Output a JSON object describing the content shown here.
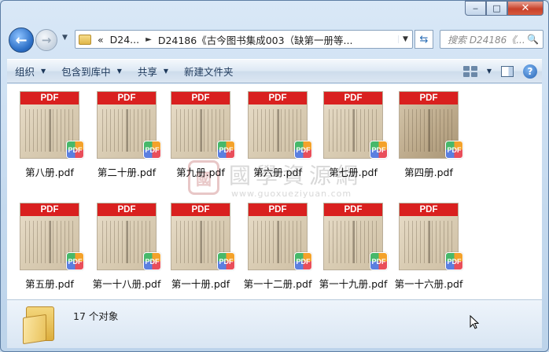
{
  "window": {
    "caption": {
      "minimize": "‒",
      "maximize": "□",
      "close": "✕"
    }
  },
  "nav": {
    "back_icon": "←",
    "forward_icon": "→",
    "history_dropdown": "▼",
    "address": {
      "overflow": "«",
      "crumb1": "D24...",
      "crumb2": "D24186《古今图书集成003（缺第一册等...",
      "dropdown": "▼"
    },
    "refresh_icon": "⇆",
    "search_placeholder": "搜索 D24186《...",
    "search_icon": "🔍"
  },
  "toolbar": {
    "organize": "组织",
    "include_library": "包含到库中",
    "share": "共享",
    "new_folder": "新建文件夹",
    "help": "?"
  },
  "files": [
    {
      "name": "第八册.pdf",
      "band": "PDF",
      "badge": "PDF"
    },
    {
      "name": "第二十册.pdf",
      "band": "PDF",
      "badge": "PDF"
    },
    {
      "name": "第九册.pdf",
      "band": "PDF",
      "badge": "PDF"
    },
    {
      "name": "第六册.pdf",
      "band": "PDF",
      "badge": "PDF"
    },
    {
      "name": "第七册.pdf",
      "band": "PDF",
      "badge": "PDF"
    },
    {
      "name": "第四册.pdf",
      "band": "PDF",
      "badge": "PDF"
    },
    {
      "name": "第五册.pdf",
      "band": "PDF",
      "badge": "PDF"
    },
    {
      "name": "第一十八册.pdf",
      "band": "PDF",
      "badge": "PDF"
    },
    {
      "name": "第一十册.pdf",
      "band": "PDF",
      "badge": "PDF"
    },
    {
      "name": "第一十二册.pdf",
      "band": "PDF",
      "badge": "PDF"
    },
    {
      "name": "第一十九册.pdf",
      "band": "PDF",
      "badge": "PDF"
    },
    {
      "name": "第一十六册.pdf",
      "band": "PDF",
      "badge": "PDF"
    }
  ],
  "watermark": {
    "seal": "國",
    "title": "國學資源網",
    "url": "www.guoxueziyuan.com"
  },
  "status": {
    "count_text": "17 个对象"
  },
  "colors": {
    "pdf_band": "#d9201f",
    "window_chrome": "#c9dcef"
  }
}
